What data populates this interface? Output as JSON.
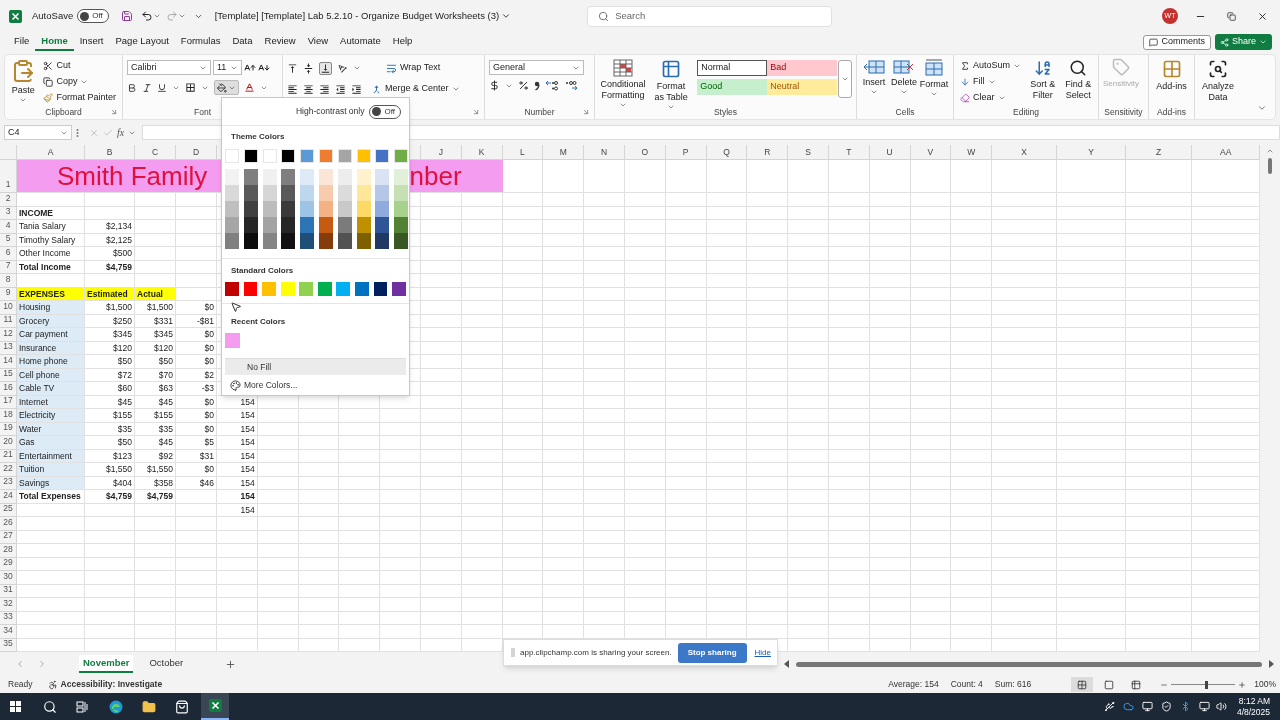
{
  "title_bar": {
    "autosave_label": "AutoSave",
    "autosave": {
      "on": false,
      "label": "Off"
    },
    "title": "[Template] [Template] Lab 5.2.10 - Organize Budget Worksheets (3)",
    "search_placeholder": "Search",
    "avatar": "WT"
  },
  "menu_tabs": [
    {
      "label": "File",
      "selected": false
    },
    {
      "label": "Home",
      "selected": true
    },
    {
      "label": "Insert",
      "selected": false
    },
    {
      "label": "Page Layout",
      "selected": false
    },
    {
      "label": "Formulas",
      "selected": false
    },
    {
      "label": "Data",
      "selected": false
    },
    {
      "label": "Review",
      "selected": false
    },
    {
      "label": "View",
      "selected": false
    },
    {
      "label": "Automate",
      "selected": false
    },
    {
      "label": "Help",
      "selected": false
    }
  ],
  "comments": "Comments",
  "share": "Share",
  "ribbon": {
    "clipboard": {
      "paste": "Paste",
      "cut": "Cut",
      "copy": "Copy",
      "format_painter": "Format Painter",
      "label": "Clipboard"
    },
    "font": {
      "name": "Calibri",
      "size": "11",
      "label": "Font"
    },
    "alignment": {
      "wrap_text": "Wrap Text",
      "merge_center": "Merge & Center"
    },
    "number": {
      "format": "General",
      "label": "Number"
    },
    "styles": {
      "conditional_formatting": "Conditional Formatting",
      "format_as_table": "Format as Table",
      "cell_styles": [
        {
          "label": "Normal",
          "color": "#ffffff"
        },
        {
          "label": "Bad",
          "color": "#ffc7ce"
        },
        {
          "label": "Good",
          "color": "#c6efce"
        },
        {
          "label": "Neutral",
          "color": "#ffeb9c"
        }
      ],
      "label": "Styles"
    },
    "cells": {
      "buttons": [
        {
          "label": "Insert",
          "kind": "insert"
        },
        {
          "label": "Delete",
          "kind": "delete"
        },
        {
          "label": "Format",
          "kind": "format"
        }
      ],
      "label": "Cells"
    },
    "editing": {
      "autosum": "AutoSum",
      "fill": "Fill",
      "clear": "Clear",
      "sort_filter": "Sort & Filter",
      "find_select": "Find & Select",
      "label": "Editing"
    },
    "sensitivity": {
      "button": "Sensitivity",
      "disabled": true,
      "label": "Sensitivity"
    },
    "addins": {
      "button": "Add-ins",
      "label": "Add-ins"
    },
    "analyze": {
      "button": "Analyze Data"
    }
  },
  "formula_bar": {
    "name_box": "C4",
    "function_label": "fx"
  },
  "columns": [
    "A",
    "B",
    "C",
    "D",
    "J",
    "K",
    "L",
    "M",
    "N",
    "O",
    "P",
    "Q",
    "R",
    "S",
    "T",
    "U",
    "V",
    "W",
    "X",
    "Y",
    "Z",
    "AA"
  ],
  "rows": [
    {
      "number": "1",
      "kind": "title",
      "title_start": "Smith Family",
      "title_end": "nber"
    },
    {
      "number": "2",
      "kind": "blank"
    },
    {
      "number": "3",
      "kind": "heading",
      "A": "INCOME"
    },
    {
      "number": "4",
      "kind": "item",
      "A": "Tania Salary",
      "B": "$2,134"
    },
    {
      "number": "5",
      "kind": "item",
      "A": "Timothy Salary",
      "B": "$2,125"
    },
    {
      "number": "6",
      "kind": "item",
      "A": "Other Income",
      "B": "$500"
    },
    {
      "number": "7",
      "kind": "total",
      "A": "Total Income",
      "B": "$4,759"
    },
    {
      "number": "8",
      "kind": "blank"
    },
    {
      "number": "9",
      "kind": "expense_header",
      "A": "EXPENSES",
      "B": "Estimated",
      "C": "Actual"
    },
    {
      "number": "10",
      "kind": "expense",
      "A": "Housing",
      "B": "$1,500",
      "C": "$1,500",
      "D": "$0"
    },
    {
      "number": "11",
      "kind": "expense",
      "A": "Grocery",
      "B": "$250",
      "C": "$331",
      "D": "-$81"
    },
    {
      "number": "12",
      "kind": "expense",
      "A": "Car payment",
      "B": "$345",
      "C": "$345",
      "D": "$0"
    },
    {
      "number": "13",
      "kind": "expense",
      "A": "Insurance",
      "B": "$120",
      "C": "$120",
      "D": "$0"
    },
    {
      "number": "14",
      "kind": "expense",
      "A": "Home phone",
      "B": "$50",
      "C": "$50",
      "D": "$0"
    },
    {
      "number": "15",
      "kind": "expense",
      "A": "Cell phone",
      "B": "$72",
      "C": "$70",
      "D": "$2"
    },
    {
      "number": "16",
      "kind": "expense",
      "A": "Cable TV",
      "B": "$60",
      "C": "$63",
      "D": "-$3"
    },
    {
      "number": "17",
      "kind": "expense",
      "A": "Internet",
      "B": "$45",
      "C": "$45",
      "D": "$0",
      "E": "154"
    },
    {
      "number": "18",
      "kind": "expense",
      "A": "Electricity",
      "B": "$155",
      "C": "$155",
      "D": "$0",
      "E": "154"
    },
    {
      "number": "19",
      "kind": "expense",
      "A": "Water",
      "B": "$35",
      "C": "$35",
      "D": "$0",
      "E": "154"
    },
    {
      "number": "20",
      "kind": "expense",
      "A": "Gas",
      "B": "$50",
      "C": "$45",
      "D": "$5",
      "E": "154"
    },
    {
      "number": "21",
      "kind": "expense",
      "A": "Entertainment",
      "B": "$123",
      "C": "$92",
      "D": "$31",
      "E": "154"
    },
    {
      "number": "22",
      "kind": "expense",
      "A": "Tuition",
      "B": "$1,550",
      "C": "$1,550",
      "D": "$0",
      "E": "154"
    },
    {
      "number": "23",
      "kind": "expense",
      "A": "Savings",
      "B": "$404",
      "C": "$358",
      "D": "$46",
      "E": "154"
    },
    {
      "number": "24",
      "kind": "total",
      "A": "Total Expenses",
      "B": "$4,759",
      "C": "$4,759",
      "E": "154"
    },
    {
      "number": "25",
      "kind": "blank",
      "E": "154"
    },
    {
      "number": "26",
      "kind": "blank"
    },
    {
      "number": "27",
      "kind": "blank"
    },
    {
      "number": "28",
      "kind": "blank"
    },
    {
      "number": "29",
      "kind": "blank"
    },
    {
      "number": "30",
      "kind": "blank"
    },
    {
      "number": "31",
      "kind": "blank"
    },
    {
      "number": "32",
      "kind": "blank"
    },
    {
      "number": "33",
      "kind": "blank"
    },
    {
      "number": "34",
      "kind": "blank"
    },
    {
      "number": "35",
      "kind": "blank"
    }
  ],
  "fill_menu": {
    "high_contrast_label": "High-contrast only",
    "high_contrast": {
      "on": false,
      "label": "Off"
    },
    "theme_title": "Theme Colors",
    "theme_colors": [
      {
        "color": "#ffffff",
        "shades": [
          {
            "color": "#f2f2f2"
          },
          {
            "color": "#d9d9d9"
          },
          {
            "color": "#bfbfbf"
          },
          {
            "color": "#a6a6a6"
          },
          {
            "color": "#808080"
          }
        ]
      },
      {
        "color": "#000000",
        "shades": [
          {
            "color": "#7f7f7f"
          },
          {
            "color": "#595959"
          },
          {
            "color": "#404040"
          },
          {
            "color": "#262626"
          },
          {
            "color": "#0d0d0d"
          }
        ]
      },
      {
        "color": "#ffffff",
        "shades": [
          {
            "color": "#f0f0f0"
          },
          {
            "color": "#d6d6d6"
          },
          {
            "color": "#bcbcbc"
          },
          {
            "color": "#a3a3a3"
          },
          {
            "color": "#858585"
          }
        ]
      },
      {
        "color": "#000000",
        "shades": [
          {
            "color": "#7f7f7f"
          },
          {
            "color": "#595959"
          },
          {
            "color": "#3a3a3a"
          },
          {
            "color": "#262626"
          },
          {
            "color": "#111111"
          }
        ]
      },
      {
        "color": "#5b9bd5",
        "shades": [
          {
            "color": "#deebf7"
          },
          {
            "color": "#bdd7ee"
          },
          {
            "color": "#9dc3e6"
          },
          {
            "color": "#2e75b6"
          },
          {
            "color": "#1f4e79"
          }
        ]
      },
      {
        "color": "#ed7d31",
        "shades": [
          {
            "color": "#fbe5d6"
          },
          {
            "color": "#f8cbad"
          },
          {
            "color": "#f4b183"
          },
          {
            "color": "#c55a11"
          },
          {
            "color": "#843c0c"
          }
        ]
      },
      {
        "color": "#a5a5a5",
        "shades": [
          {
            "color": "#ededed"
          },
          {
            "color": "#dbdbdb"
          },
          {
            "color": "#c9c9c9"
          },
          {
            "color": "#7b7b7b"
          },
          {
            "color": "#525252"
          }
        ]
      },
      {
        "color": "#ffc000",
        "shades": [
          {
            "color": "#fff2cc"
          },
          {
            "color": "#ffe699"
          },
          {
            "color": "#ffd966"
          },
          {
            "color": "#bf9000"
          },
          {
            "color": "#7f6000"
          }
        ]
      },
      {
        "color": "#4472c4",
        "shades": [
          {
            "color": "#dae3f3"
          },
          {
            "color": "#b4c7e7"
          },
          {
            "color": "#8faadc"
          },
          {
            "color": "#2f5597"
          },
          {
            "color": "#203864"
          }
        ]
      },
      {
        "color": "#70ad47",
        "shades": [
          {
            "color": "#e2f0d9"
          },
          {
            "color": "#c5e0b4"
          },
          {
            "color": "#a9d18e"
          },
          {
            "color": "#548235"
          },
          {
            "color": "#385723"
          }
        ]
      }
    ],
    "standard_title": "Standard Colors",
    "standard_colors": [
      {
        "color": "#c00000"
      },
      {
        "color": "#ff0000"
      },
      {
        "color": "#ffc000"
      },
      {
        "color": "#ffff00"
      },
      {
        "color": "#92d050"
      },
      {
        "color": "#00b050"
      },
      {
        "color": "#00b0f0"
      },
      {
        "color": "#0070c0"
      },
      {
        "color": "#002060"
      },
      {
        "color": "#7030a0"
      }
    ],
    "recent_title": "Recent Colors",
    "recent_colors": [
      {
        "color": "#f49cf0"
      }
    ],
    "no_fill": "No Fill",
    "more_colors": "More Colors..."
  },
  "sheet_tabs": [
    {
      "label": "November",
      "selected": true
    },
    {
      "label": "October",
      "selected": false
    }
  ],
  "sharing_bar": {
    "message": "app.clipchamp.com is sharing your screen.",
    "stop": "Stop sharing",
    "hide": "Hide"
  },
  "status_bar": {
    "ready": "Ready",
    "accessibility": "Accessibility: Investigate",
    "average": "Average: 154",
    "count": "Count: 4",
    "sum": "Sum: 616",
    "views": [
      {
        "kind": "normal",
        "selected": true
      },
      {
        "kind": "page_layout",
        "selected": false
      },
      {
        "kind": "page_break",
        "selected": false
      }
    ],
    "zoom": {
      "level": 0.55,
      "reading": "100%"
    }
  },
  "taskbar": {
    "time": "8:12 AM",
    "date": "4/8/2025"
  }
}
